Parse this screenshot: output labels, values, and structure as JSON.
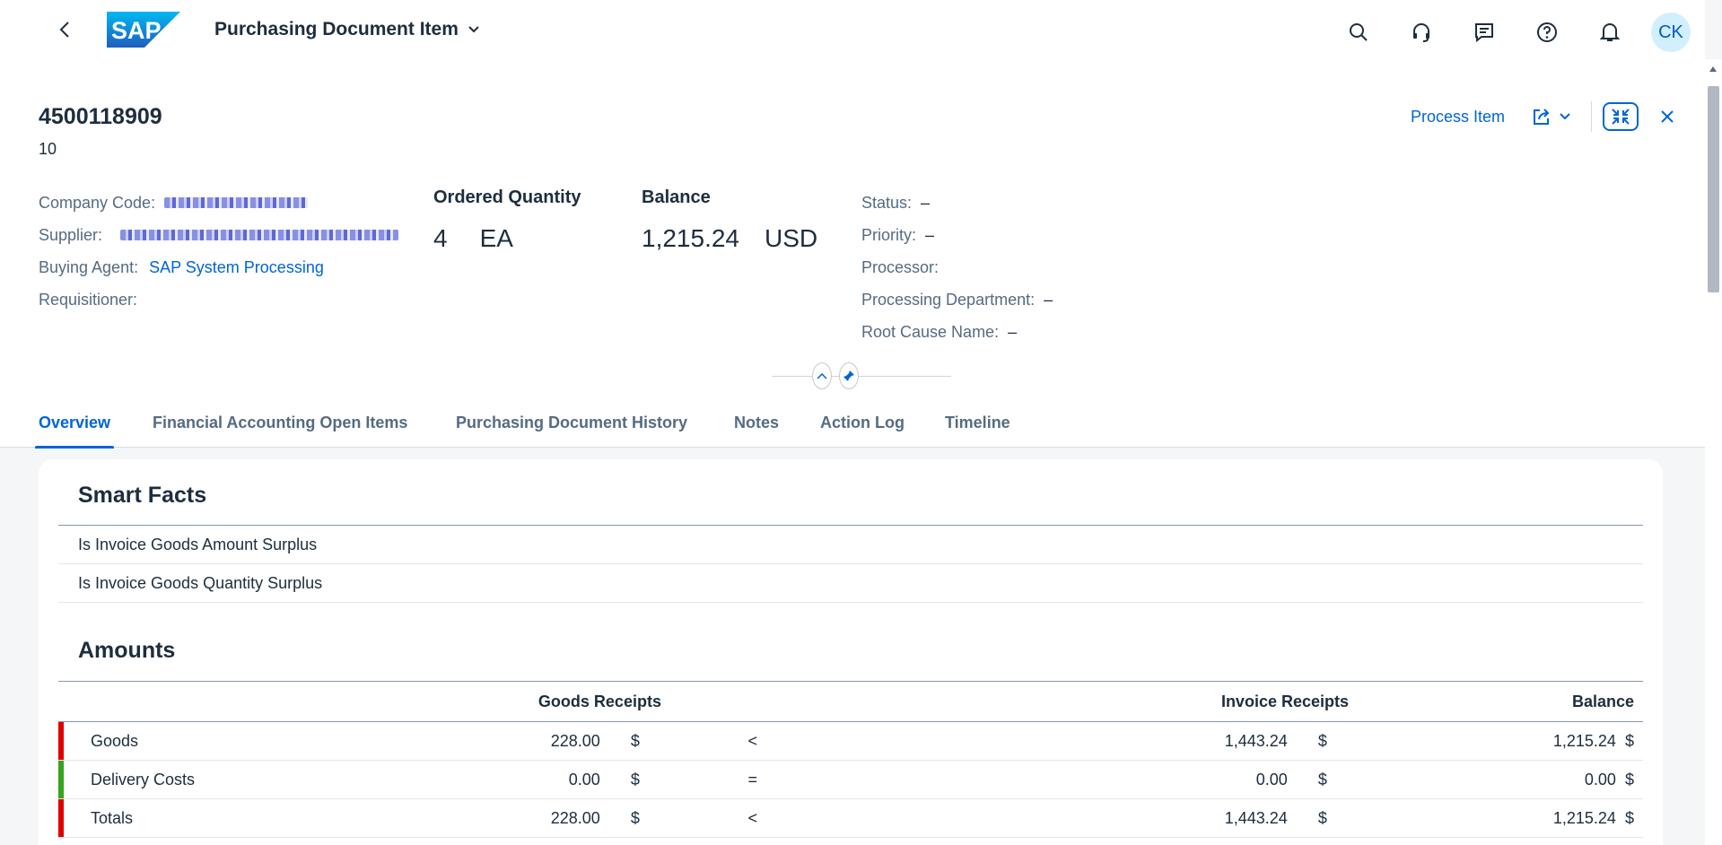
{
  "shell": {
    "logo_text": "SAP",
    "app_title": "Purchasing Document Item",
    "avatar_initials": "CK",
    "icons": [
      "back-icon",
      "search-icon",
      "support-icon",
      "feedback-icon",
      "help-icon",
      "notifications-icon"
    ],
    "colors": {
      "brand": "#0064d9",
      "logo": "#1a73cc"
    }
  },
  "header": {
    "title": "4500118909",
    "subtitle": "10",
    "actions": {
      "process_item": "Process Item"
    },
    "fields_left": {
      "company_code_label": "Company Code:",
      "supplier_label": "Supplier:",
      "buying_agent_label": "Buying Agent:",
      "buying_agent_value": "SAP System Processing",
      "requisitioner_label": "Requisitioner:"
    },
    "kpis": [
      {
        "label": "Ordered Quantity",
        "value": "4",
        "unit": "EA"
      },
      {
        "label": "Balance",
        "value": "1,215.24",
        "unit": "USD"
      }
    ],
    "fields_right": {
      "status_label": "Status:",
      "status_value": "–",
      "priority_label": "Priority:",
      "priority_value": "–",
      "processor_label": "Processor:",
      "processing_dept_label": "Processing Department:",
      "processing_dept_value": "–",
      "root_cause_label": "Root Cause Name:",
      "root_cause_value": "–"
    }
  },
  "tabs": [
    "Overview",
    "Financial Accounting Open Items",
    "Purchasing Document History",
    "Notes",
    "Action Log",
    "Timeline"
  ],
  "smart_facts": {
    "title": "Smart Facts",
    "items": [
      "Is Invoice Goods Amount Surplus",
      "Is Invoice Goods Quantity Surplus"
    ]
  },
  "amounts": {
    "title": "Amounts",
    "headers": {
      "goods_receipts": "Goods Receipts",
      "invoice_receipts": "Invoice Receipts",
      "balance": "Balance"
    },
    "rows": [
      {
        "name": "Goods",
        "gr": "228.00",
        "gr_cur": "$",
        "cmp": "<",
        "ir": "1,443.24",
        "ir_cur": "$",
        "bal": "1,215.24",
        "bal_cur": "$",
        "indicator": "#e00000"
      },
      {
        "name": "Delivery Costs",
        "gr": "0.00",
        "gr_cur": "$",
        "cmp": "=",
        "ir": "0.00",
        "ir_cur": "$",
        "bal": "0.00",
        "bal_cur": "$",
        "indicator": "#36a41d"
      },
      {
        "name": "Totals",
        "gr": "228.00",
        "gr_cur": "$",
        "cmp": "<",
        "ir": "1,443.24",
        "ir_cur": "$",
        "bal": "1,215.24",
        "bal_cur": "$",
        "indicator": "#e00000"
      }
    ]
  }
}
